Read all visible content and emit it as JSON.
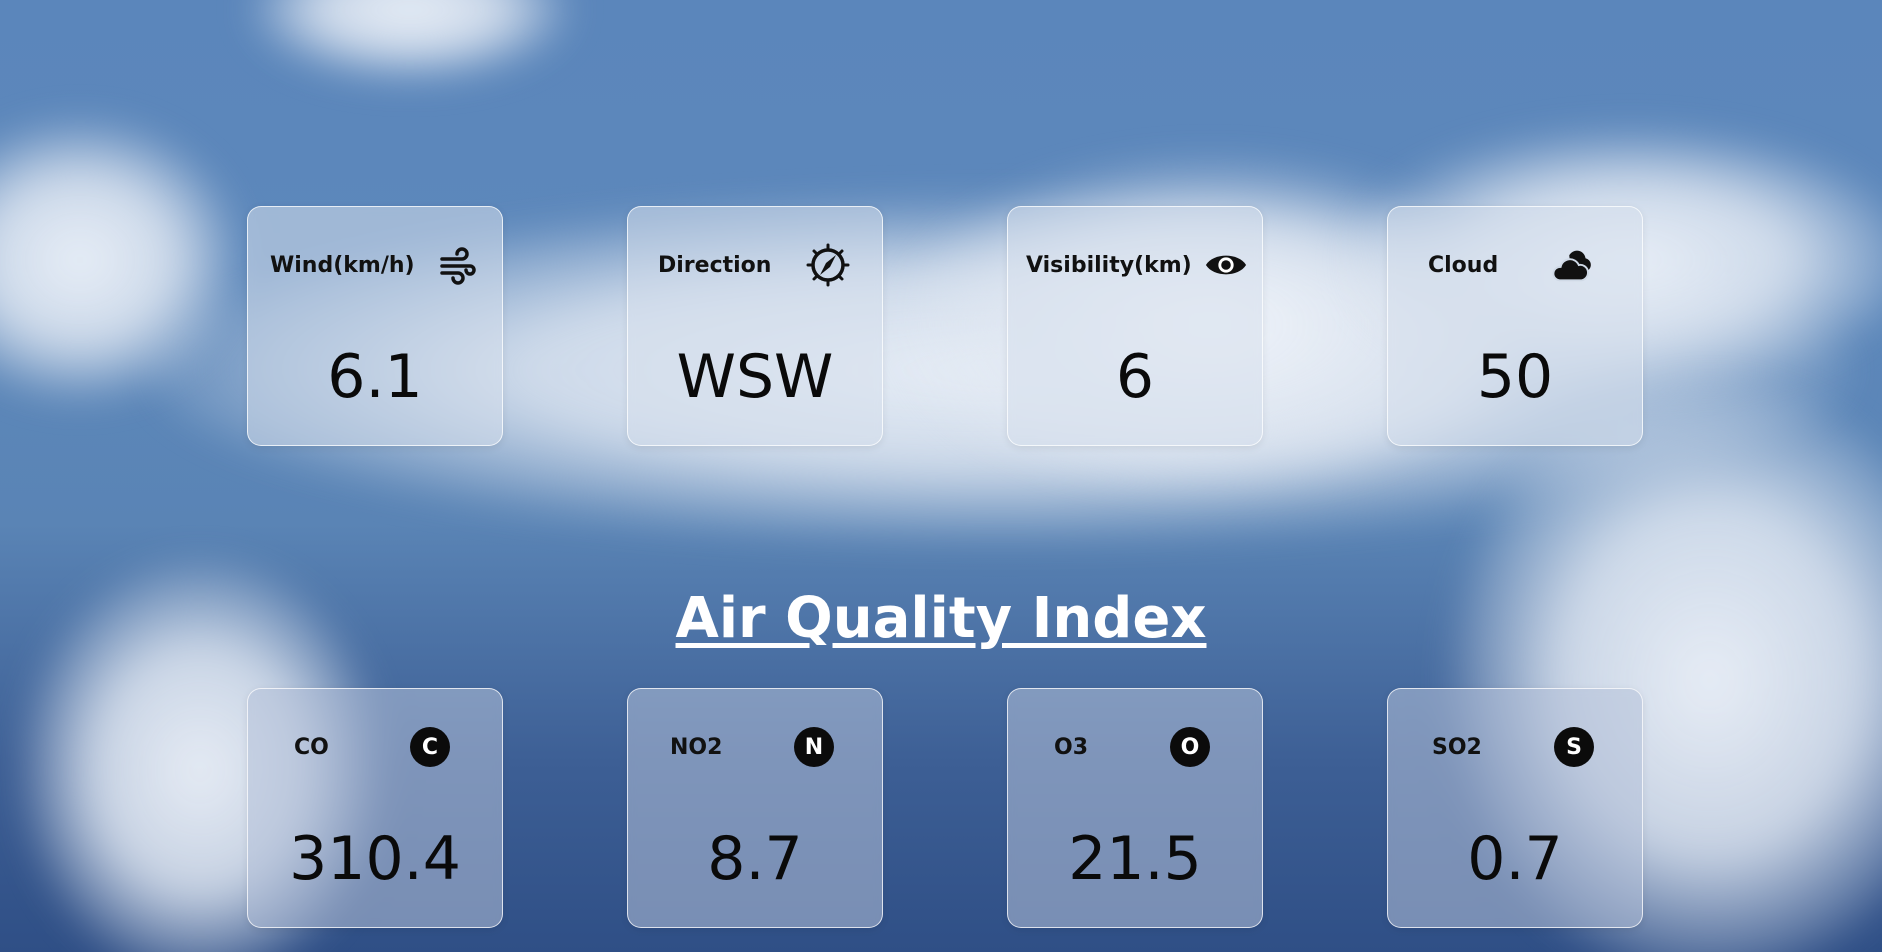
{
  "weather_cards": [
    {
      "label": "Wind(km/h)",
      "value": "6.1",
      "icon": "wind-icon"
    },
    {
      "label": "Direction",
      "value": "WSW",
      "icon": "compass-icon"
    },
    {
      "label": "Visibility(km)",
      "value": "6",
      "icon": "eye-icon"
    },
    {
      "label": "Cloud",
      "value": "50",
      "icon": "cloud-icon"
    }
  ],
  "air_quality": {
    "title": "Air Quality Index",
    "cards": [
      {
        "label": "CO",
        "value": "310.4",
        "badge": "C",
        "icon": "letter-c-icon"
      },
      {
        "label": "NO2",
        "value": "8.7",
        "badge": "N",
        "icon": "letter-n-icon"
      },
      {
        "label": "O3",
        "value": "21.5",
        "badge": "O",
        "icon": "letter-o-icon"
      },
      {
        "label": "SO2",
        "value": "0.7",
        "badge": "S",
        "icon": "letter-s-icon"
      }
    ]
  },
  "colors": {
    "sky": "#5b86bb",
    "card_border": "#ffffff",
    "text": "#111111",
    "title": "#ffffff"
  }
}
